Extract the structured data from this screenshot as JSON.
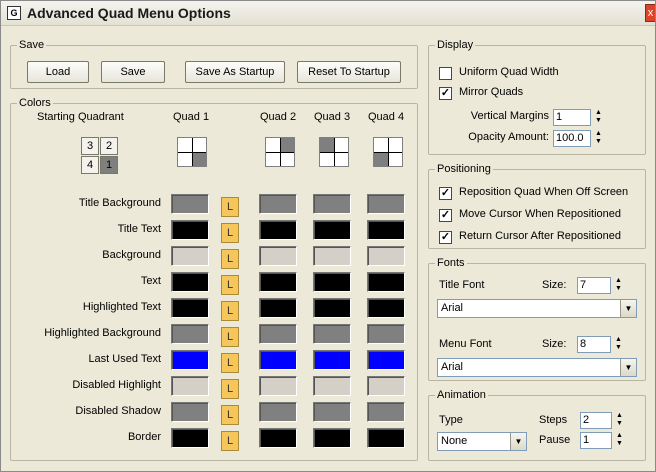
{
  "window": {
    "title": "Advanced Quad Menu Options",
    "icon": "menu-options-icon"
  },
  "save": {
    "legend": "Save",
    "buttons": [
      "Load",
      "Save",
      "Save As Startup",
      "Reset To Startup"
    ]
  },
  "colors": {
    "legend": "Colors",
    "starting_quadrant_label": "Starting Quadrant",
    "quadrant_buttons": [
      "3",
      "2",
      "4",
      "1"
    ],
    "quad_headers": [
      "Quad 1",
      "Quad 2",
      "Quad 3",
      "Quad 4"
    ],
    "lock_label": "L",
    "rows": [
      {
        "label": "Title Background",
        "colors": [
          "#808080",
          "#808080",
          "#808080",
          "#808080"
        ]
      },
      {
        "label": "Title Text",
        "colors": [
          "#000000",
          "#000000",
          "#000000",
          "#000000"
        ]
      },
      {
        "label": "Background",
        "colors": [
          "#d4d0c8",
          "#d4d0c8",
          "#d4d0c8",
          "#d4d0c8"
        ]
      },
      {
        "label": "Text",
        "colors": [
          "#000000",
          "#000000",
          "#000000",
          "#000000"
        ]
      },
      {
        "label": "Highlighted Text",
        "colors": [
          "#000000",
          "#000000",
          "#000000",
          "#000000"
        ]
      },
      {
        "label": "Highlighted Background",
        "colors": [
          "#808080",
          "#808080",
          "#808080",
          "#808080"
        ]
      },
      {
        "label": "Last Used Text",
        "colors": [
          "#0000ff",
          "#0000ff",
          "#0000ff",
          "#0000ff"
        ]
      },
      {
        "label": "Disabled Highlight",
        "colors": [
          "#d4d0c8",
          "#d4d0c8",
          "#d4d0c8",
          "#d4d0c8"
        ]
      },
      {
        "label": "Disabled Shadow",
        "colors": [
          "#808080",
          "#808080",
          "#808080",
          "#808080"
        ]
      },
      {
        "label": "Border",
        "colors": [
          "#000000",
          "#000000",
          "#000000",
          "#000000"
        ]
      }
    ]
  },
  "display": {
    "legend": "Display",
    "uniform_quad_width": {
      "label": "Uniform Quad Width",
      "checked": false
    },
    "mirror_quads": {
      "label": "Mirror Quads",
      "checked": true
    },
    "vertical_margins": {
      "label": "Vertical Margins",
      "value": "1"
    },
    "opacity_amount": {
      "label": "Opacity Amount:",
      "value": "100.0"
    }
  },
  "positioning": {
    "legend": "Positioning",
    "options": [
      {
        "label": "Reposition Quad When Off Screen",
        "checked": true
      },
      {
        "label": "Move Cursor When Repositioned",
        "checked": true
      },
      {
        "label": "Return Cursor After Repositioned",
        "checked": true
      }
    ]
  },
  "fonts": {
    "legend": "Fonts",
    "title_font": {
      "label": "Title Font",
      "size_label": "Size:",
      "size": "7",
      "font": "Arial"
    },
    "menu_font": {
      "label": "Menu Font",
      "size_label": "Size:",
      "size": "8",
      "font": "Arial"
    }
  },
  "animation": {
    "legend": "Animation",
    "type_label": "Type",
    "type_value": "None",
    "steps_label": "Steps",
    "steps_value": "2",
    "pause_label": "Pause",
    "pause_value": "1"
  },
  "glyphs": {
    "check": "✓",
    "up": "▲",
    "down": "▼",
    "close": "x"
  }
}
